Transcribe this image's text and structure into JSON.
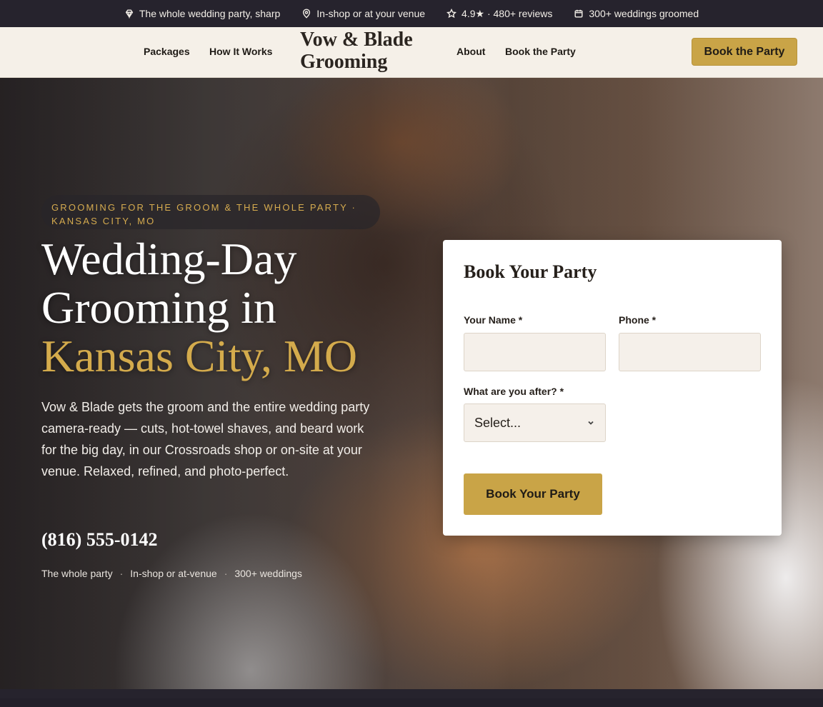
{
  "topbar": {
    "items": [
      {
        "icon": "diamond-icon",
        "text": "The whole wedding party, sharp"
      },
      {
        "icon": "map-pin-icon",
        "text": "In-shop or at your venue"
      },
      {
        "icon": "star-icon",
        "text": "4.9★ · 480+ reviews"
      },
      {
        "icon": "calendar-icon",
        "text": "300+ weddings groomed"
      }
    ]
  },
  "nav": {
    "links": [
      "Packages",
      "How It Works",
      "About",
      "Book the Party"
    ],
    "logo_line1": "Vow & Blade",
    "logo_line2": "Grooming",
    "cta": "Book the Party"
  },
  "hero": {
    "eyebrow_line1": "GROOMING FOR THE GROOM & THE WHOLE PARTY ·",
    "eyebrow_line2": "KANSAS CITY, MO",
    "headline_line1": "Wedding-Day",
    "headline_line2": "Grooming in",
    "headline_accent": "Kansas City, MO",
    "lede": "Vow & Blade gets the groom and the entire wedding party camera-ready — cuts, hot-towel shaves, and beard work for the big day, in our Crossroads shop or on-site at your venue. Relaxed, refined, and photo-perfect.",
    "phone": "(816) 555-0142",
    "trust": [
      "The whole party",
      "In-shop or at-venue",
      "300+ weddings"
    ],
    "trust_separator": "·"
  },
  "form": {
    "title": "Book Your Party",
    "name_label": "Your Name *",
    "name_value": "",
    "phone_label": "Phone *",
    "phone_value": "",
    "service_label": "What are you after? *",
    "service_selected": "Select...",
    "submit": "Book Your Party"
  },
  "colors": {
    "accent_gold": "#c9a447",
    "topbar_bg": "#26232d",
    "nav_bg": "#f5f0e8"
  }
}
